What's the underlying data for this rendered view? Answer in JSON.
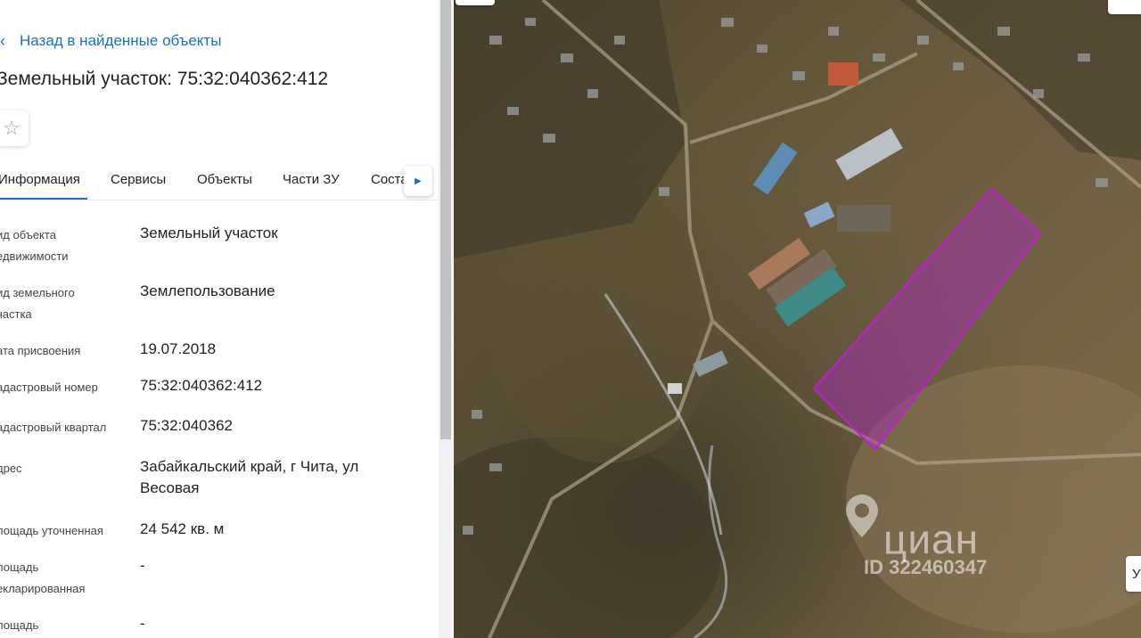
{
  "panel": {
    "back_label": "Назад в найденные объекты",
    "title": "Земельный участок: 75:32:040362:412",
    "tabs": [
      "Информация",
      "Сервисы",
      "Объекты",
      "Части ЗУ",
      "Соста"
    ],
    "active_tab": "Информация",
    "fields": [
      {
        "label_lines": [
          "ид объекта",
          "едвижимости"
        ],
        "value_lines": [
          "Земельный участок"
        ]
      },
      {
        "label_lines": [
          "ид земельного",
          "частка"
        ],
        "value_lines": [
          "Землепользование"
        ]
      },
      {
        "label_lines": [
          "ата присвоения"
        ],
        "value_lines": [
          "19.07.2018"
        ]
      },
      {
        "label_lines": [
          "адастровый номер"
        ],
        "value_lines": [
          "75:32:040362:412"
        ]
      },
      {
        "label_lines": [
          "адастровый квартал"
        ],
        "value_lines": [
          "75:32:040362"
        ]
      },
      {
        "label_lines": [
          "дрес"
        ],
        "value_lines": [
          "Забайкальский край, г Чита, ул",
          "Весовая"
        ]
      },
      {
        "label_lines": [
          "лощадь уточненная"
        ],
        "value_lines": [
          "24 542 кв. м"
        ]
      },
      {
        "label_lines": [
          "лощадь",
          "екларированная"
        ],
        "value_lines": [
          "-"
        ]
      },
      {
        "label_lines": [
          "лощадь"
        ],
        "value_lines": [
          "-"
        ]
      }
    ]
  },
  "icons": {
    "back": "chevron-left-icon",
    "favorite": "star-outline-icon",
    "tabs_next": "caret-right-icon",
    "watermark_logo": "location-pin-icon"
  },
  "colors": {
    "accent": "#1a6ec7",
    "parcel_stroke": "#c21ed0",
    "parcel_fill": "rgba(170,40,190,0.45)"
  },
  "map": {
    "watermark_brand": "циан",
    "watermark_id": "ID 322460347",
    "edge_button_label": "У"
  }
}
